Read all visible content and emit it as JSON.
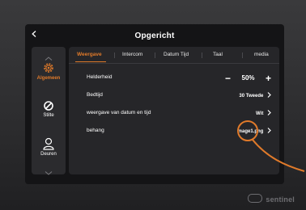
{
  "header": {
    "back_icon": "chevron-left-icon",
    "title": "Opgericht"
  },
  "sidebar": {
    "up_icon": "chevron-up-icon",
    "down_icon": "chevron-down-icon",
    "items": [
      {
        "label": "Algemeen",
        "icon": "gear-icon",
        "active": true
      },
      {
        "label": "Stilte",
        "icon": "mute-icon",
        "active": false
      },
      {
        "label": "Deuren",
        "icon": "person-icon",
        "active": false
      }
    ]
  },
  "tabs": [
    {
      "label": "Weergave",
      "active": true
    },
    {
      "label": "Intercom",
      "active": false
    },
    {
      "label": "Datum Tijd",
      "active": false
    },
    {
      "label": "Taal",
      "active": false
    },
    {
      "label": "media",
      "active": false
    }
  ],
  "settings": {
    "brightness": {
      "label": "Helderheid",
      "minus": "−",
      "value": "50%",
      "plus": "+"
    },
    "bedtime": {
      "label": "Bedtijd",
      "value": "30 Tweede"
    },
    "datetime": {
      "label": "weergave van datum en tijd",
      "value": "Wit"
    },
    "wallpaper": {
      "label": "behang",
      "value": "mage1.png"
    }
  },
  "brand": {
    "logo_text": "sentinel"
  },
  "colors": {
    "accent": "#e07a2a",
    "panel": "#262629",
    "screen": "#141416"
  }
}
